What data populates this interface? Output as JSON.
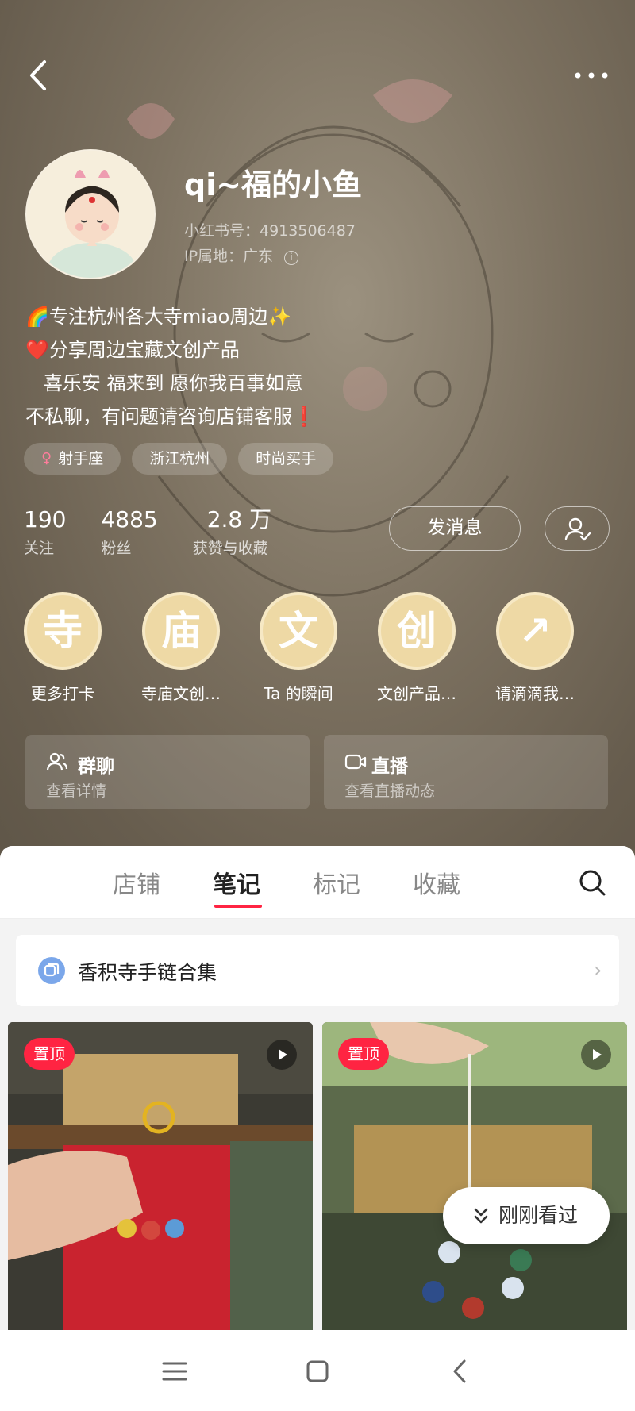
{
  "profile": {
    "username": "qi~福的小鱼",
    "uid": "小红书号：4913506487",
    "ip": "IP属地：广东",
    "bio": [
      "🌈专注杭州各大寺miao周边✨",
      "❤️分享周边宝藏文创产品",
      "   喜乐安 福来到 愿你我百事如意",
      "不私聊，有问题请咨询店铺客服❗"
    ],
    "tags": [
      "射手座",
      "浙江杭州",
      "时尚买手"
    ],
    "stats": [
      {
        "value": "190",
        "label": "关注"
      },
      {
        "value": "4885",
        "label": "粉丝"
      },
      {
        "value": "2.8 万",
        "label": "获赞与收藏"
      }
    ],
    "message_label": "发消息"
  },
  "highlights": [
    {
      "glyph": "寺",
      "label": "更多打卡"
    },
    {
      "glyph": "庙",
      "label": "寺庙文创…"
    },
    {
      "glyph": "文",
      "label": "Ta 的瞬间"
    },
    {
      "glyph": "创",
      "label": "文创产品…"
    },
    {
      "glyph": "↗",
      "label": "请滴滴我…"
    }
  ],
  "cards": [
    {
      "title": "群聊",
      "subtitle": "查看详情",
      "icon": "group-icon"
    },
    {
      "title": "直播",
      "subtitle": "查看直播动态",
      "icon": "live-icon"
    }
  ],
  "tabs": [
    "店铺",
    "笔记",
    "标记",
    "收藏"
  ],
  "active_tab": "笔记",
  "collection": {
    "title": "香积寺手链合集"
  },
  "posts": [
    {
      "badge": "置顶",
      "media": "video"
    },
    {
      "badge": "置顶",
      "media": "video"
    }
  ],
  "just_seen": "刚刚看过",
  "colors": {
    "accent": "#ff2442",
    "highlight_bg": "#eed9a5",
    "hero_bg": "#7c7160"
  }
}
